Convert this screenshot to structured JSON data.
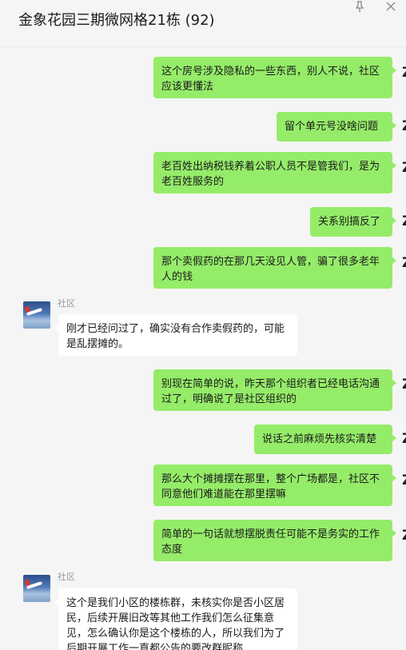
{
  "window": {
    "title": "金象花园三期微网格21栋 (92)",
    "icons": [
      "pin-icon",
      "close-icon"
    ]
  },
  "messages": [
    {
      "side": "out",
      "text": "这个房号涉及隐私的一些东西，别人不说，社区应该更懂法"
    },
    {
      "side": "out",
      "text": "留个单元号没啥问题"
    },
    {
      "side": "out",
      "text": "老百姓出纳税钱养着公职人员不是管我们，是为老百姓服务的"
    },
    {
      "side": "out",
      "text": "关系别搞反了"
    },
    {
      "side": "out",
      "text": "那个卖假药的在那几天没见人管，骗了很多老年人的钱"
    },
    {
      "side": "in",
      "sender": "社区",
      "text": "刚才已经问过了，确实没有合作卖假药的，可能是乱摆摊的。"
    },
    {
      "side": "out",
      "text": "别现在简单的说，昨天那个组织者已经电话沟通过了，明确说了是社区组织的"
    },
    {
      "side": "out",
      "text": "说话之前麻烦先核实清楚"
    },
    {
      "side": "out",
      "text": "那么大个摊摊摆在那里，整个广场都是，社区不同意他们难道能在那里摆嘛"
    },
    {
      "side": "out",
      "text": "简单的一句话就想摆脱责任可能不是务实的工作态度"
    },
    {
      "side": "in",
      "sender": "社区",
      "text": "这个是我们小区的楼栋群，未核实你是否小区居民，后续开展旧改等其他工作我们怎么征集意见，怎么确认你是这个楼栋的人，所以我们为了后期开展工作一直都公告的要改群昵称"
    }
  ],
  "colors": {
    "outgoing_bubble": "#95ec69",
    "incoming_bubble": "#ffffff",
    "background": "#f5f5f5"
  }
}
